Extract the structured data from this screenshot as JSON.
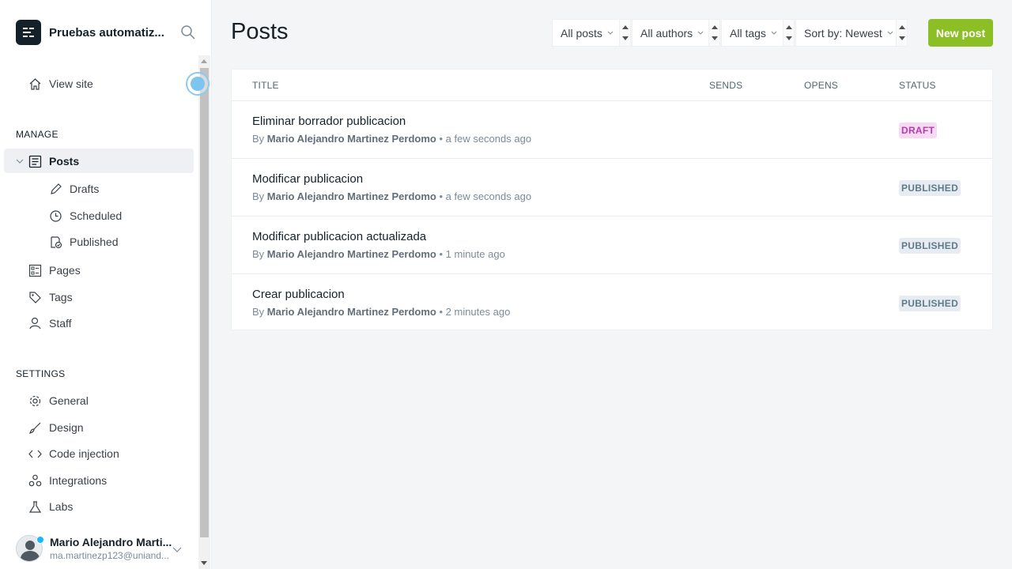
{
  "brand": {
    "name": "Pruebas automatización",
    "display": "Pruebas automatiz..."
  },
  "sidebar": {
    "view_site": "View site",
    "manage_title": "MANAGE",
    "posts": "Posts",
    "drafts": "Drafts",
    "scheduled": "Scheduled",
    "published": "Published",
    "pages": "Pages",
    "tags": "Tags",
    "staff": "Staff",
    "settings_title": "SETTINGS",
    "general": "General",
    "design": "Design",
    "code_injection": "Code injection",
    "integrations": "Integrations",
    "labs": "Labs"
  },
  "user": {
    "name": "Mario Alejandro Marti...",
    "email": "ma.martinezp123@uniand..."
  },
  "header": {
    "title": "Posts",
    "filters": {
      "type": "All posts",
      "author": "All authors",
      "tag": "All tags",
      "sort": "Sort by: Newest"
    },
    "new_post": "New post"
  },
  "table": {
    "columns": {
      "title": "TITLE",
      "sends": "SENDS",
      "opens": "OPENS",
      "status": "STATUS"
    },
    "rows": [
      {
        "title": "Eliminar borrador publicacion",
        "by": "By",
        "author": "Mario Alejandro Martinez Perdomo",
        "time": "• a few seconds ago",
        "status": "DRAFT"
      },
      {
        "title": "Modificar publicacion",
        "by": "By",
        "author": "Mario Alejandro Martinez Perdomo",
        "time": "• a few seconds ago",
        "status": "PUBLISHED"
      },
      {
        "title": "Modificar publicacion actualizada",
        "by": "By",
        "author": "Mario Alejandro Martinez Perdomo",
        "time": "• 1 minute ago",
        "status": "PUBLISHED"
      },
      {
        "title": "Crear publicacion",
        "by": "By",
        "author": "Mario Alejandro Martinez Perdomo",
        "time": "• 2 minutes ago",
        "status": "PUBLISHED"
      }
    ]
  },
  "colors": {
    "accent_green": "#8cbe26",
    "draft_bg": "#f7d9f4",
    "draft_text": "#b33ea8",
    "published_bg": "#e6ecf1",
    "published_text": "#5f7a89"
  }
}
